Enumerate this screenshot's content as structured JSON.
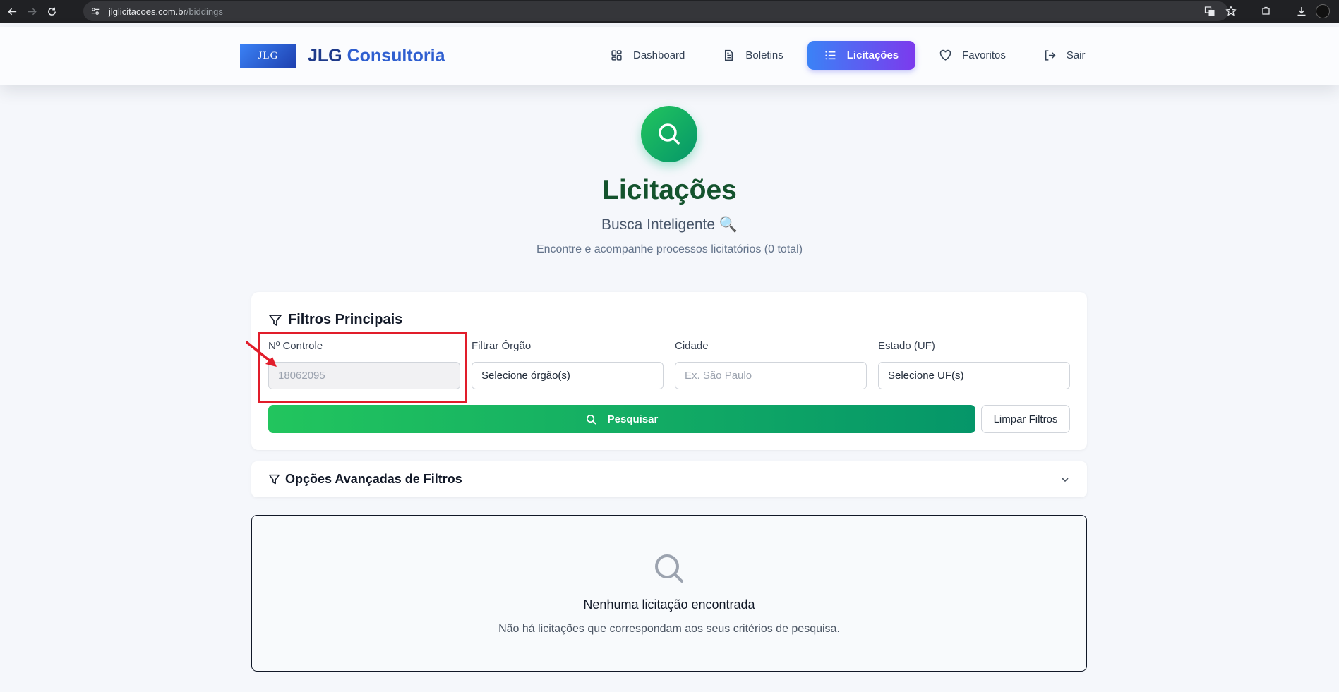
{
  "browser": {
    "url_host": "jlglicitacoes.com.br",
    "url_path": "/biddings"
  },
  "header": {
    "logo_text": "JLG",
    "brand_name_part1": "JLG ",
    "brand_name_part2": "Consultoria",
    "nav": [
      {
        "label": "Dashboard",
        "icon": "dashboard-icon"
      },
      {
        "label": "Boletins",
        "icon": "document-icon"
      },
      {
        "label": "Licitações",
        "icon": "list-icon",
        "active": true
      },
      {
        "label": "Favoritos",
        "icon": "heart-icon"
      },
      {
        "label": "Sair",
        "icon": "logout-icon"
      }
    ]
  },
  "hero": {
    "title": "Licitações",
    "subtitle": "Busca Inteligente 🔍",
    "description": "Encontre e acompanhe processos licitatórios (0 total)"
  },
  "filters": {
    "title": "Filtros Principais",
    "controle": {
      "label": "Nº Controle",
      "value": "18062095"
    },
    "orgao": {
      "label": "Filtrar Órgão",
      "value": "Selecione órgão(s)"
    },
    "cidade": {
      "label": "Cidade",
      "placeholder": "Ex. São Paulo"
    },
    "estado": {
      "label": "Estado (UF)",
      "value": "Selecione UF(s)"
    },
    "search_button": "Pesquisar",
    "clear_button": "Limpar Filtros"
  },
  "advanced": {
    "title": "Opções Avançadas de Filtros"
  },
  "empty_state": {
    "title": "Nenhuma licitação encontrada",
    "description": "Não há licitações que correspondam aos seus critérios de pesquisa."
  },
  "colors": {
    "accent_green": "#22c55e",
    "accent_blue": "#3b82f6",
    "accent_purple": "#7c3aed",
    "highlight_red": "#e11d2a"
  }
}
